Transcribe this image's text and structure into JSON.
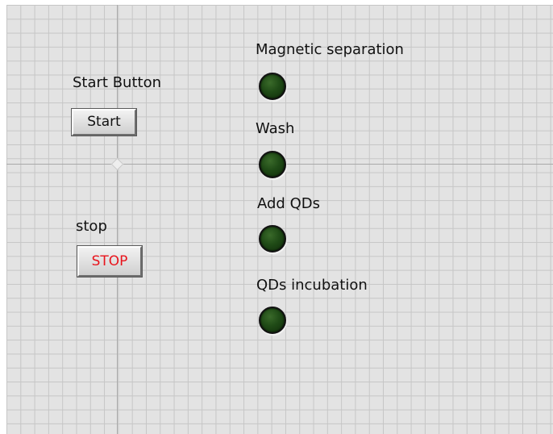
{
  "controls": {
    "start": {
      "label": "Start Button",
      "button_text": "Start"
    },
    "stop": {
      "label": "stop",
      "button_text": "STOP",
      "text_color": "#e8141c"
    }
  },
  "indicators": [
    {
      "label": "Magnetic separation",
      "state": "off",
      "color": "#1f4a16"
    },
    {
      "label": "Wash",
      "state": "off",
      "color": "#1f4a16"
    },
    {
      "label": "Add QDs",
      "state": "off",
      "color": "#1f4a16"
    },
    {
      "label": "QDs incubation",
      "state": "off",
      "color": "#1f4a16"
    }
  ],
  "panel": {
    "background": "#e3e3e3",
    "grid_color": "#c6c6c6"
  }
}
